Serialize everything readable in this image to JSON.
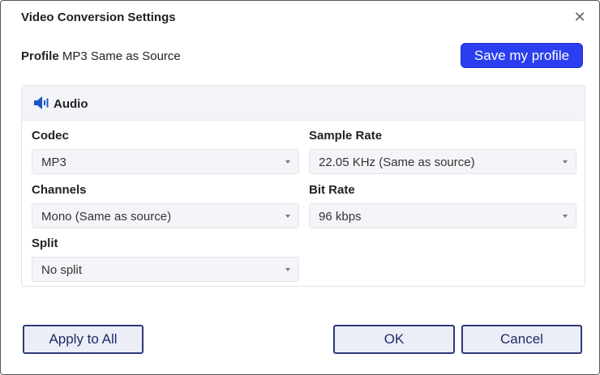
{
  "dialog": {
    "title": "Video Conversion Settings",
    "close_symbol": "✕"
  },
  "profile": {
    "label": "Profile",
    "value": "MP3 Same as Source",
    "save_label": "Save my profile"
  },
  "audio": {
    "section_title": "Audio",
    "icon": "speaker-icon",
    "codec": {
      "label": "Codec",
      "value": "MP3"
    },
    "sample_rate": {
      "label": "Sample Rate",
      "value": "22.05 KHz (Same as source)"
    },
    "channels": {
      "label": "Channels",
      "value": "Mono (Same as source)"
    },
    "bit_rate": {
      "label": "Bit Rate",
      "value": "96 kbps"
    },
    "split": {
      "label": "Split",
      "value": "No split"
    }
  },
  "footer": {
    "apply_all_label": "Apply to All",
    "ok_label": "OK",
    "cancel_label": "Cancel"
  },
  "colors": {
    "accent": "#2b3ff0",
    "button_border": "#2d3a7a",
    "panel_header": "#f3f4f8"
  }
}
